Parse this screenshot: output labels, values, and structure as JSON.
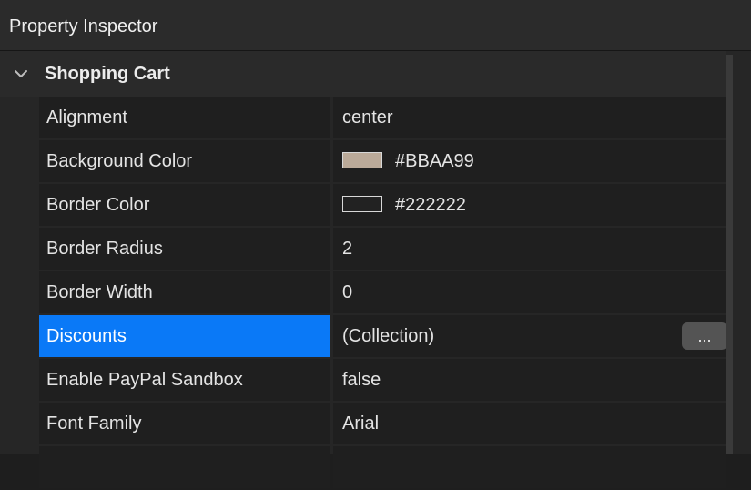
{
  "window": {
    "title": "Property Inspector"
  },
  "group": {
    "title": "Shopping Cart",
    "expanded": true,
    "icon": "chevron-down-icon"
  },
  "properties": [
    {
      "name": "Alignment",
      "value": "center"
    },
    {
      "name": "Background Color",
      "value": "#BBAA99",
      "swatch": "#BBAA99"
    },
    {
      "name": "Border Color",
      "value": "#222222",
      "swatch": "#222222"
    },
    {
      "name": "Border Radius",
      "value": "2"
    },
    {
      "name": "Border Width",
      "value": "0"
    },
    {
      "name": "Discounts",
      "value": "(Collection)",
      "selected": true,
      "button_label": "..."
    },
    {
      "name": "Enable PayPal Sandbox",
      "value": "false"
    },
    {
      "name": "Font Family",
      "value": "Arial"
    },
    {
      "name": "",
      "value": ""
    }
  ],
  "colors": {
    "selection": "#0a79f7",
    "background": "#1e1e1e"
  }
}
